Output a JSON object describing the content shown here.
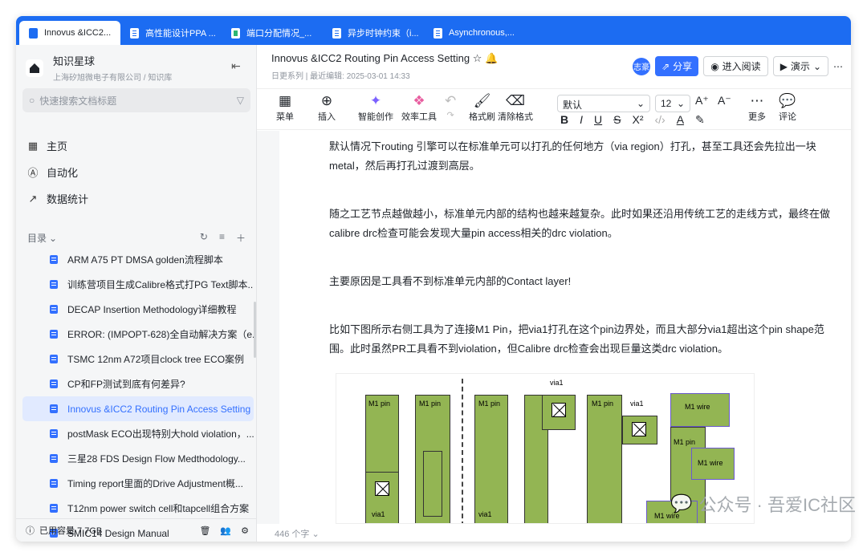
{
  "tabs": [
    {
      "label": "Innovus &ICC2...",
      "active": true,
      "icon": "doc"
    },
    {
      "label": "高性能设计PPA ...",
      "active": false,
      "icon": "doc"
    },
    {
      "label": "端口分配情况_...",
      "active": false,
      "icon": "sheet"
    },
    {
      "label": "异步时钟约束（i...",
      "active": false,
      "icon": "doc"
    },
    {
      "label": "Asynchronous,...",
      "active": false,
      "icon": "doc"
    }
  ],
  "sidebar": {
    "kb_title": "知识星球",
    "kb_sub": "上海矽旭微电子有限公司 / 知识库",
    "search_placeholder": "快速搜索文档标题",
    "nav": [
      {
        "label": "主页",
        "icon": "grid-icon"
      },
      {
        "label": "自动化",
        "icon": "automation-icon"
      },
      {
        "label": "数据统计",
        "icon": "chart-icon"
      }
    ],
    "toc_label": "目录",
    "toc": [
      "ARM A75 PT DMSA golden流程脚本",
      "训练营项目生成Calibre格式打PG Text脚本...",
      "DECAP Insertion Methodology详细教程",
      "ERROR: (IMPOPT-628)全自动解决方案（e...",
      "TSMC 12nm A72项目clock tree ECO案例",
      "CP和FP测试到底有何差异?",
      "Innovus &ICC2 Routing Pin Access Setting",
      "postMask ECO出现特别大hold violation，...",
      "三星28 FDS Design Flow Medthodology...",
      "Timing report里面的Drive Adjustment概...",
      "T12nm power switch cell和tapcell组合方案",
      "SMIC14 Design Manual"
    ],
    "selected_index": 6,
    "capacity": "已用容量 7.7GB"
  },
  "header": {
    "doc_title": "Innovus &ICC2 Routing Pin Access Setting",
    "meta_series": "日更系列",
    "meta_edit": "最近编辑: 2025-03-01 14:33",
    "avatar": "志豪",
    "share": "分享",
    "read_mode": "进入阅读",
    "present": "演示"
  },
  "toolbar": {
    "menu": "菜单",
    "insert": "插入",
    "ai": "智能创作",
    "tools": "效率工具",
    "brush": "格式刷",
    "clear": "清除格式",
    "font": "默认",
    "size": "12",
    "more": "更多",
    "comment": "评论"
  },
  "content": {
    "p1": "默认情况下routing 引擎可以在标准单元可以打孔的任何地方（via region）打孔，甚至工具还会先拉出一块metal，然后再打孔过渡到高层。",
    "p2": "随之工艺节点越做越小，标准单元内部的结构也越来越复杂。此时如果还沿用传统工艺的走线方式，最终在做calibre drc检查可能会发现大量pin access相关的drc violation。",
    "p3": "主要原因是工具看不到标准单元内部的Contact layer!",
    "p4": "比如下图所示右侧工具为了连接M1 Pin，把via1打孔在这个pin边界处，而且大部分via1超出这个pin shape范围。此时虽然PR工具看不到violation，但Calibre drc检查会出现巨量这类drc violation。",
    "figure_labels": {
      "m1pin": "M1 pin",
      "via1": "via1",
      "m1wire": "M1 wire"
    }
  },
  "footer": {
    "word_count": "446 个字",
    "watermark": "公众号 · 吾爱IC社区"
  },
  "colors": {
    "accent": "#1c6cf2",
    "metal": "#93b553",
    "selected_bg": "#e1eaff"
  }
}
